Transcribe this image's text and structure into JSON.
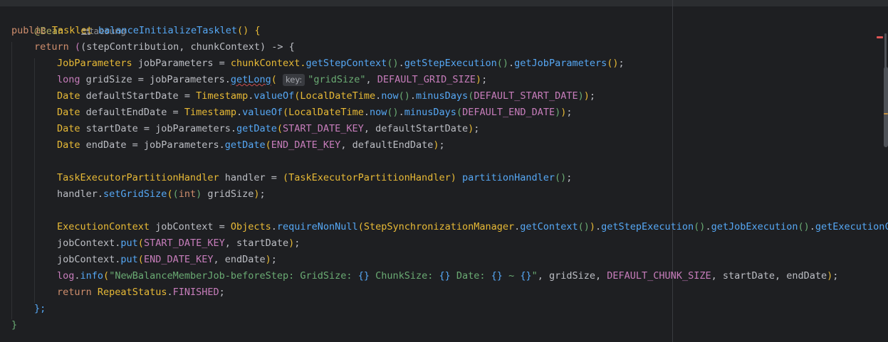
{
  "editor": {
    "annotation": "@Bean",
    "author": "taesung",
    "inlay_hint": "key:",
    "lines": {
      "l2_kw": "public",
      "l2_type": "Tasklet",
      "l2_method": "balanceInitializeTasklet",
      "l3_return": "return",
      "l3_params": "(stepContribution, chunkContext) -> {",
      "l4_type": "JobParameters",
      "l4_var": " jobParameters = ",
      "l4_ctx": "chunkContext.",
      "l4_m1": "getStepContext",
      "l4_m2": "getStepExecution",
      "l4_m3": "getJobParameters",
      "l5_type": "long",
      "l5_var": " gridSize = jobParameters.",
      "l5_m": "getLong",
      "l5_str": "\"gridSize\"",
      "l5_const": "DEFAULT_GRID_SIZE",
      "l6_type": "Date",
      "l6_var": " defaultStartDate = ",
      "l6_ts": "Timestamp",
      "l6_m1": "valueOf",
      "l6_ldt": "LocalDateTime",
      "l6_m2": "now",
      "l6_m3": "minusDays",
      "l6_const": "DEFAULT_START_DATE",
      "l7_type": "Date",
      "l7_var": " defaultEndDate = ",
      "l7_ts": "Timestamp",
      "l7_m1": "valueOf",
      "l7_ldt": "LocalDateTime",
      "l7_m2": "now",
      "l7_m3": "minusDays",
      "l7_const": "DEFAULT_END_DATE",
      "l8_type": "Date",
      "l8_var": " startDate = jobParameters.",
      "l8_m": "getDate",
      "l8_const": "START_DATE_KEY",
      "l8_arg": ", defaultStartDate",
      "l9_type": "Date",
      "l9_var": " endDate = jobParameters.",
      "l9_m": "getDate",
      "l9_const": "END_DATE_KEY",
      "l9_arg": ", defaultEndDate",
      "l11_type": "TaskExecutorPartitionHandler",
      "l11_var": " handler = ",
      "l11_cast": "TaskExecutorPartitionHandler",
      "l11_m": "partitionHandler",
      "l12_var": "handler.",
      "l12_m": "setGridSize",
      "l12_int": "int",
      "l12_arg": " gridSize",
      "l14_type": "ExecutionContext",
      "l14_var": " jobContext = ",
      "l14_obj": "Objects",
      "l14_m1": "requireNonNull",
      "l14_ssm": "StepSynchronizationManager",
      "l14_m2": "getContext",
      "l14_m3": "getStepExecution",
      "l14_m4": "getJobExecution",
      "l14_m5": "getExecutionCo",
      "l15_var": "jobContext.",
      "l15_m": "put",
      "l15_const": "START_DATE_KEY",
      "l15_arg": ", startDate",
      "l16_var": "jobContext.",
      "l16_m": "put",
      "l16_const": "END_DATE_KEY",
      "l16_arg": ", endDate",
      "l17_log": "log",
      "l17_m": "info",
      "l17_str1": "\"NewBalanceMemberJob-beforeStep: GridSize: ",
      "l17_ph1": "{}",
      "l17_str2": " ChunkSize: ",
      "l17_ph2": "{}",
      "l17_str3": " Date: ",
      "l17_ph3": "{}",
      "l17_str4": " ~ ",
      "l17_ph4": "{}",
      "l17_str5": "\"",
      "l17_args1": ", gridSize, ",
      "l17_const": "DEFAULT_CHUNK_SIZE",
      "l17_args2": ", startDate, endDate",
      "l18_return": "return",
      "l18_cls": "RepeatStatus",
      "l18_field": "FINISHED",
      "l19": "};",
      "l20": "}"
    }
  },
  "colors": {
    "background": "#1e1f22",
    "keyword": "#cf8e6d",
    "method": "#56a8f5",
    "string": "#6aab73",
    "constant": "#c77dbb",
    "class": "#e8ba36"
  }
}
